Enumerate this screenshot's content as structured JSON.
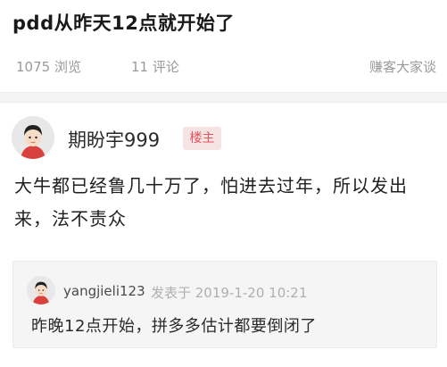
{
  "post": {
    "title": "pdd从昨天12点就开始了",
    "views": "1075 浏览",
    "comments": "11 评论",
    "forum": "赚客大家谈"
  },
  "main_post": {
    "author": "期盼宇999",
    "badge": "楼主",
    "body": "大牛都已经鲁几十万了，怕进去过年，所以发出来，法不责众"
  },
  "reply": {
    "user": "yangjieli123",
    "posted_at": "发表于 2019-1-20 10:21",
    "text": "昨晚12点开始，拼多多估计都要倒闭了"
  },
  "colors": {
    "badge_bg": "#f6e3e3",
    "badge_text": "#e0555c",
    "meta_text": "#9a9a9a"
  }
}
